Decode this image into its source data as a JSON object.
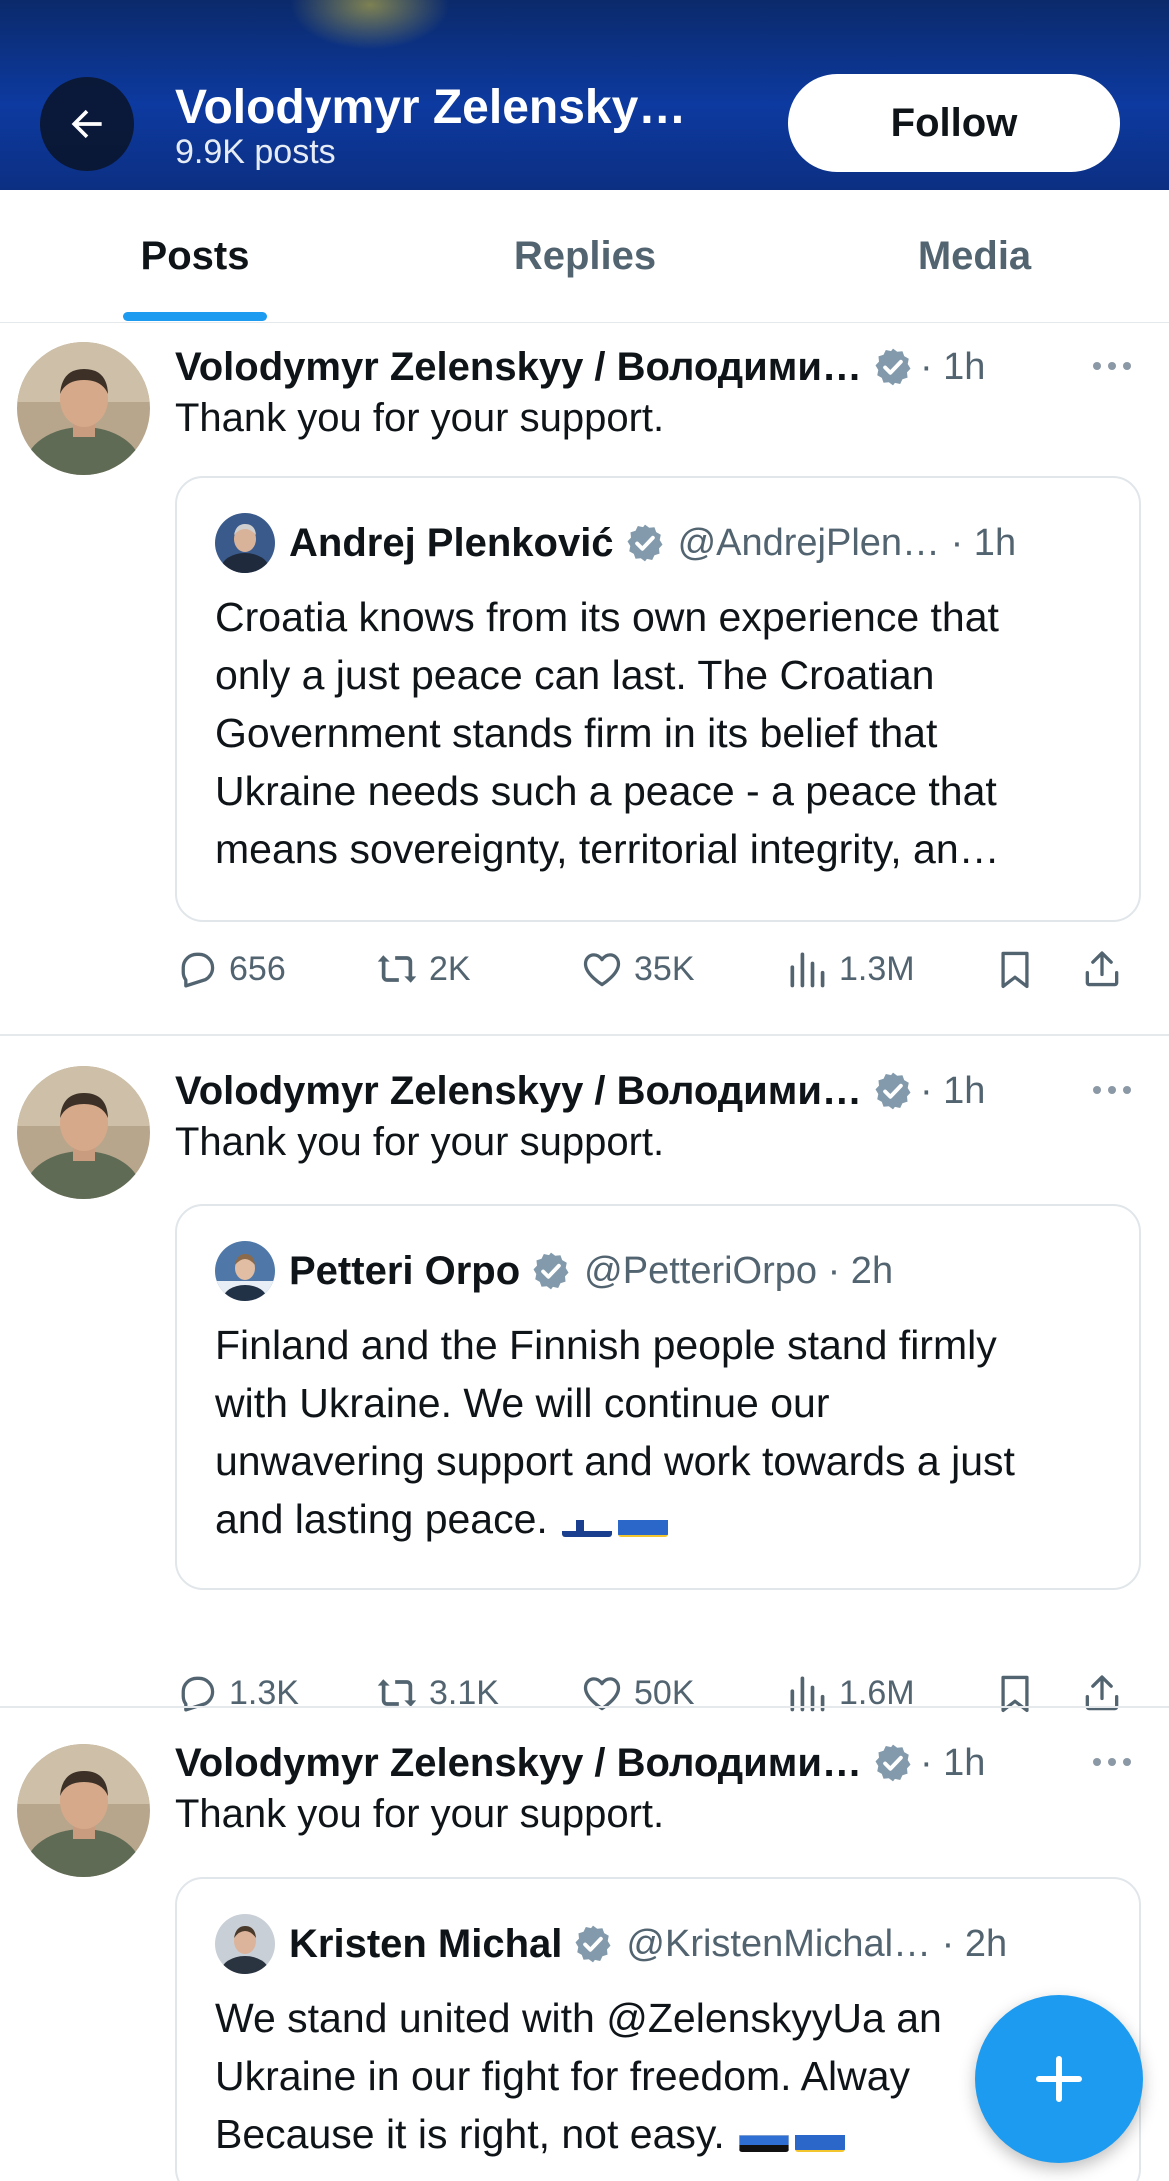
{
  "header": {
    "title": "Volodymyr Zelensky…",
    "posts_count": "9.9K posts",
    "follow_label": "Follow",
    "back_icon": "arrow-left-icon"
  },
  "tabs": [
    {
      "label": "Posts",
      "active": true
    },
    {
      "label": "Replies",
      "active": false
    },
    {
      "label": "Media",
      "active": false
    }
  ],
  "posts": [
    {
      "author": "Volodymyr Zelenskyy / Володими…",
      "time": "· 1h",
      "text": "Thank you for your support.",
      "quote": {
        "name": "Andrej Plenković",
        "handle": "@AndrejPlen… · 1h",
        "lines": [
          "Croatia knows from its own experience that",
          "only a just peace can last. The Croatian",
          "Government stands firm in its belief that",
          "Ukraine needs such a peace - a peace that",
          "means sovereignty, territorial integrity, an…"
        ]
      },
      "stats": {
        "replies": "656",
        "reposts": "2K",
        "likes": "35K",
        "views": "1.3M"
      }
    },
    {
      "author": "Volodymyr Zelenskyy / Володими…",
      "time": "· 1h",
      "text": "Thank you for your support.",
      "quote": {
        "name": "Petteri Orpo",
        "handle": "@PetteriOrpo · 2h",
        "lines": [
          "Finland and the Finnish people stand firmly",
          "with Ukraine. We will continue our",
          "unwavering support and work towards a just",
          "and lasting peace."
        ],
        "flags": [
          "finland-flag",
          "ukraine-flag"
        ]
      },
      "stats": {
        "replies": "1.3K",
        "reposts": "3.1K",
        "likes": "50K",
        "views": "1.6M"
      }
    },
    {
      "author": "Volodymyr Zelenskyy / Володими…",
      "time": "· 1h",
      "text": "Thank you for your support.",
      "quote": {
        "name": "Kristen Michal",
        "handle": "@KristenMichal… · 2h",
        "lines": [
          "We stand united with @ZelenskyyUa an",
          "Ukraine in our fight for freedom. Alway",
          "Because it is right, not easy."
        ],
        "flags": [
          "estonia-flag",
          "ukraine-flag"
        ]
      }
    }
  ],
  "fab": {
    "icon": "plus-icon"
  },
  "colors": {
    "accent": "#1d9bf0",
    "header_bg": "#0d3aa0",
    "muted_text": "#536471"
  }
}
